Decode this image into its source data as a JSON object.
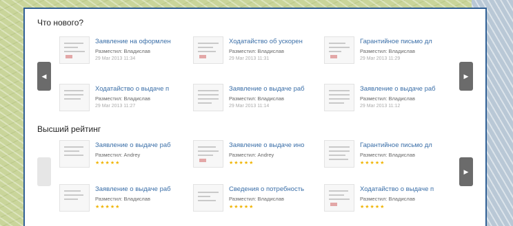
{
  "sections": [
    {
      "title": "Что нового?",
      "items": [
        {
          "title": "Заявление на оформлен",
          "author": "Разместил: Владислав",
          "meta": "29 Mar 2013 11:34"
        },
        {
          "title": "Ходатайство об ускорен",
          "author": "Разместил: Владислав",
          "meta": "29 Mar 2013 11:31"
        },
        {
          "title": "Гарантийное письмо дл",
          "author": "Разместил: Владислав",
          "meta": "29 Mar 2013 11:29"
        },
        {
          "title": "Ходатайство о выдаче п",
          "author": "Разместил: Владислав",
          "meta": "29 Mar 2013 11:27"
        },
        {
          "title": "Заявление о выдаче раб",
          "author": "Разместил: Владислав",
          "meta": "29 Mar 2013 11:14"
        },
        {
          "title": "Заявление о выдаче раб",
          "author": "Разместил: Владислав",
          "meta": "29 Mar 2013 11:12"
        }
      ]
    },
    {
      "title": "Высший рейтинг",
      "items": [
        {
          "title": "Заявление о выдаче раб",
          "author": "Разместил: Andrey",
          "meta": "★★★★★"
        },
        {
          "title": "Заявление о выдаче ино",
          "author": "Разместил: Andrey",
          "meta": "★★★★★"
        },
        {
          "title": "Гарантийное письмо дл",
          "author": "Разместил: Владислав",
          "meta": "★★★★★"
        },
        {
          "title": "Заявление о выдаче раб",
          "author": "Разместил: Владислав",
          "meta": "★★★★★"
        },
        {
          "title": "Сведения о потребность",
          "author": "Разместил: Владислав",
          "meta": "★★★★★"
        },
        {
          "title": "Ходатайство о выдаче п",
          "author": "Разместил: Владислав",
          "meta": "★★★★★"
        }
      ]
    }
  ],
  "arrows": {
    "prev": "◀",
    "next": "▶"
  },
  "colors": {
    "panel_border": "#2f5f95",
    "link": "#3b6fa8",
    "star": "#f0b400"
  }
}
